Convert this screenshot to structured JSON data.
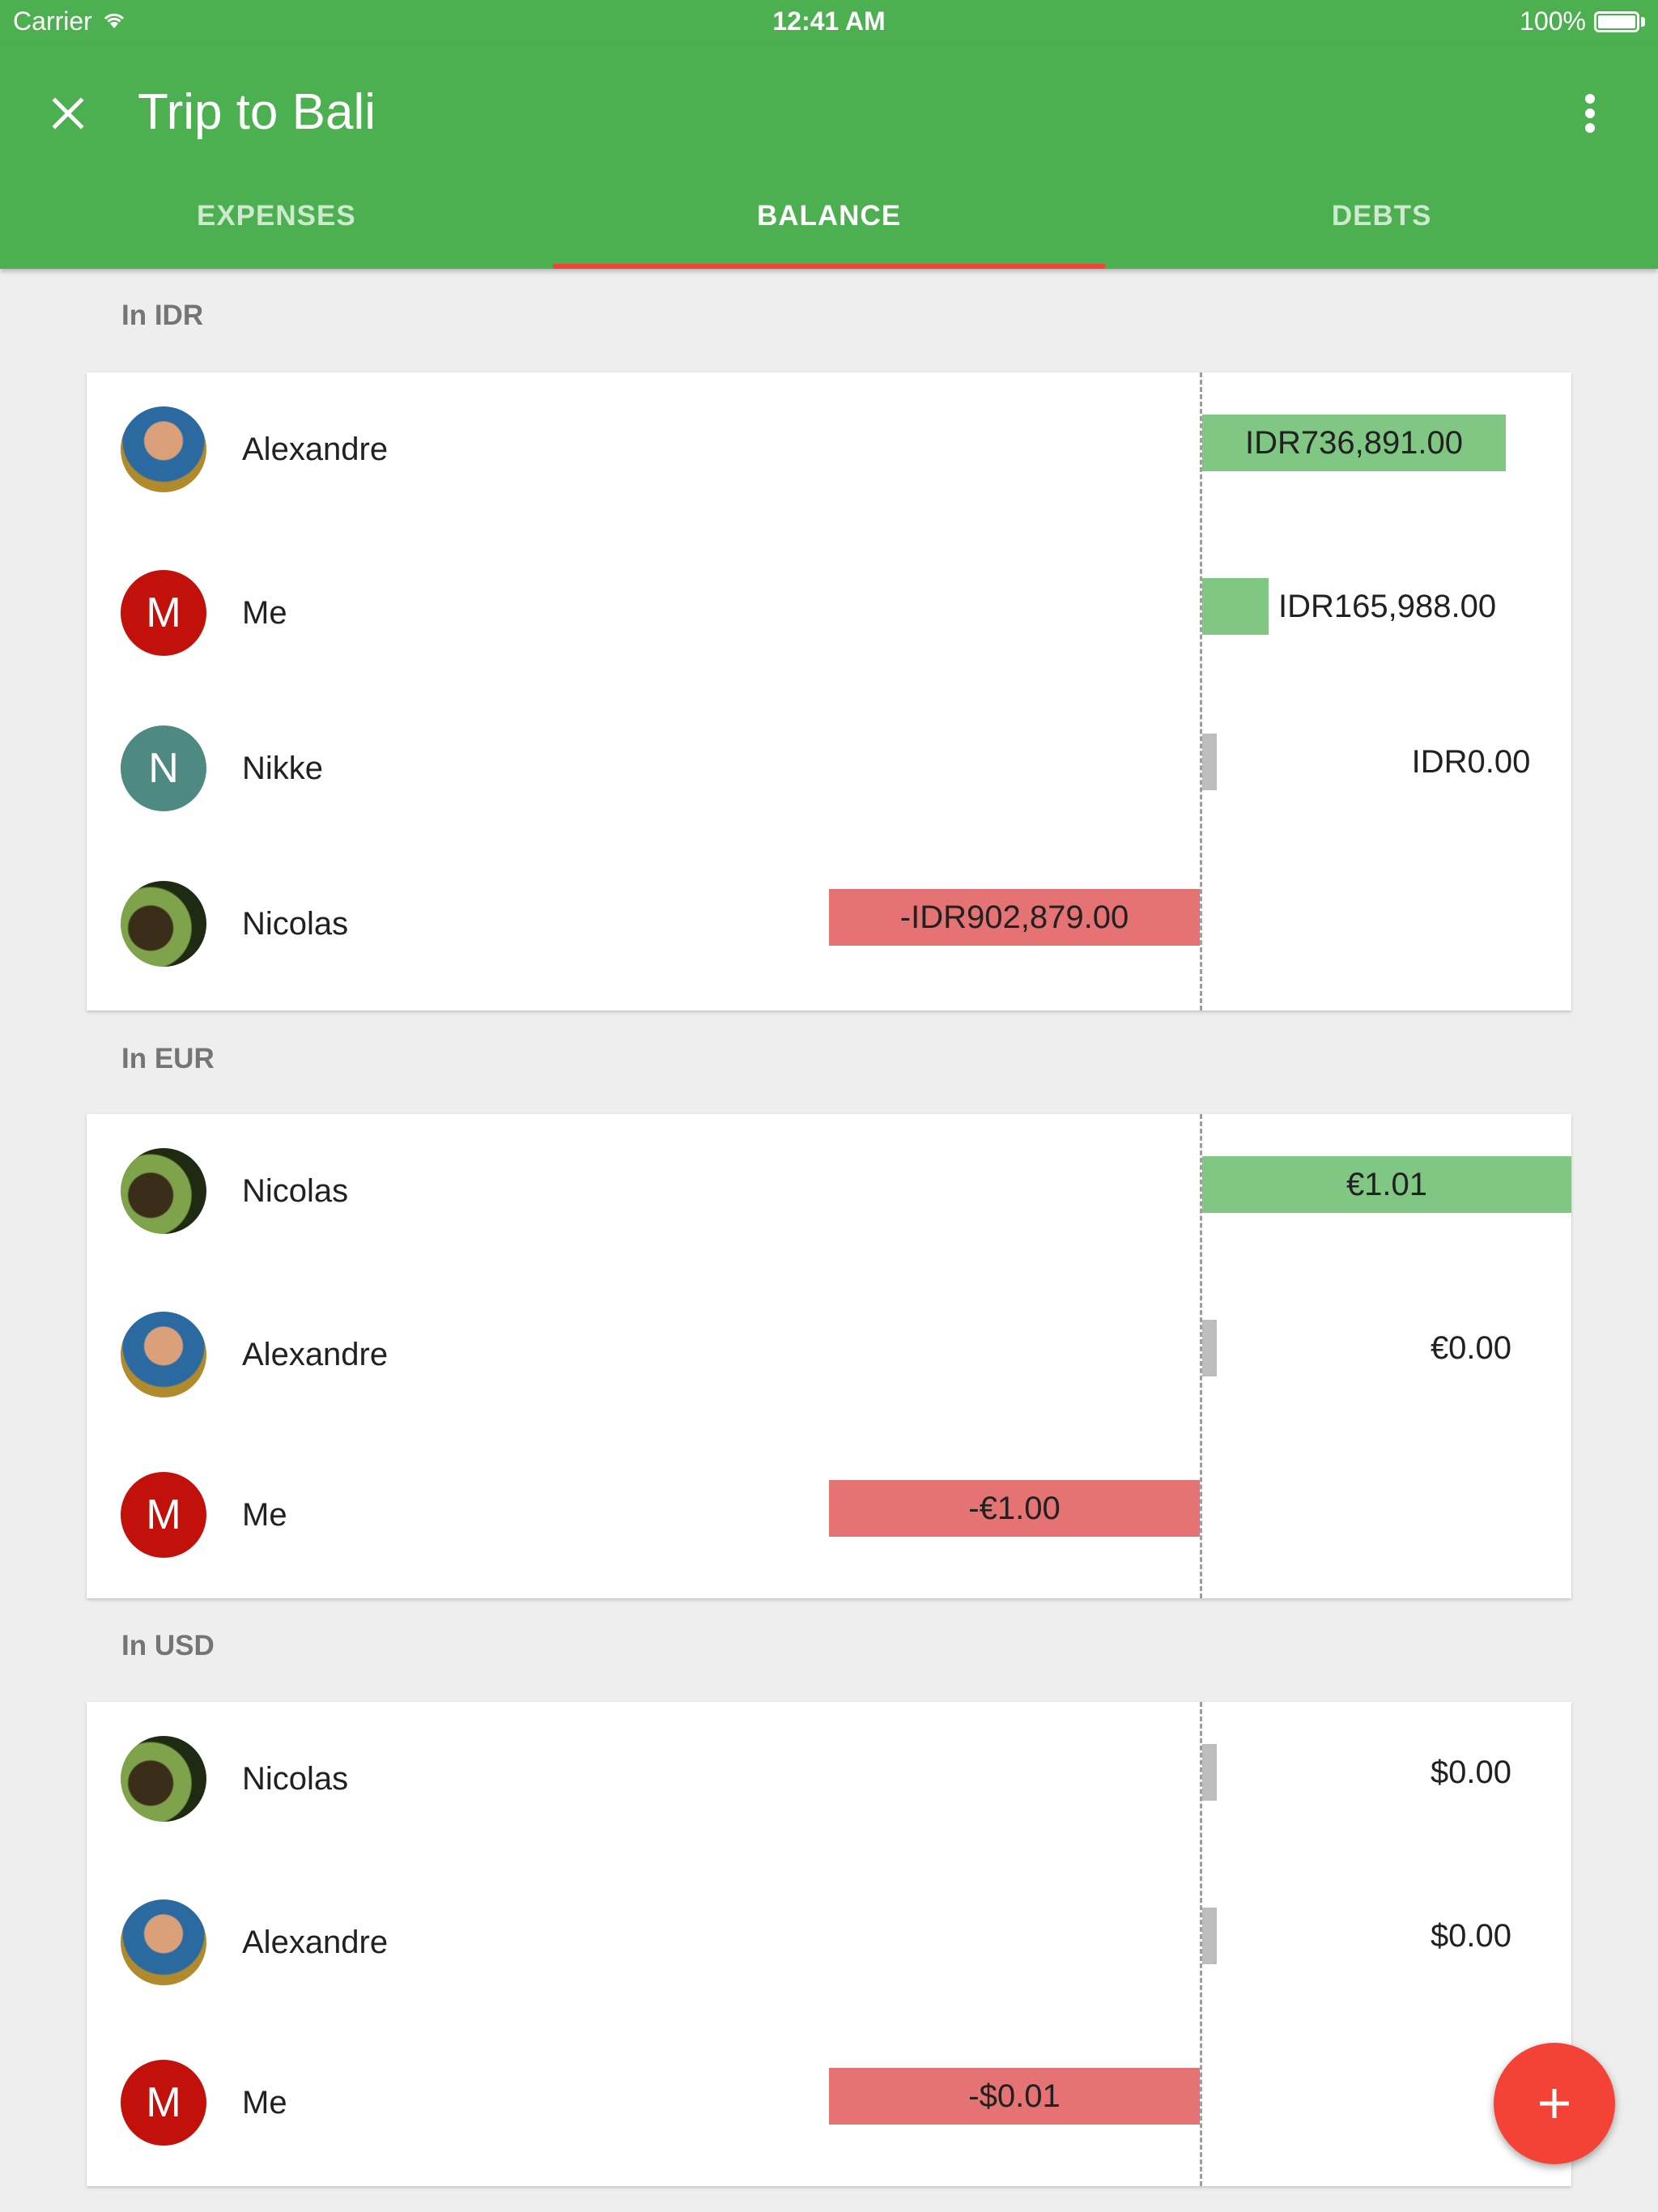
{
  "status_bar": {
    "carrier": "Carrier",
    "time": "12:41 AM",
    "battery": "100%"
  },
  "app_bar": {
    "title": "Trip to Bali",
    "tabs": [
      {
        "label": "EXPENSES",
        "active": false
      },
      {
        "label": "BALANCE",
        "active": true
      },
      {
        "label": "DEBTS",
        "active": false
      }
    ]
  },
  "colors": {
    "primary": "#4caf50",
    "accent": "#f44336",
    "positive": "#81c784",
    "negative": "#e57373",
    "zero": "#bdbdbd"
  },
  "sections": [
    {
      "label": "In IDR",
      "rows": [
        {
          "name": "Alexandre",
          "avatar": "photo",
          "amount": "IDR736,891.00",
          "value": 736891.0
        },
        {
          "name": "Me",
          "avatar": "M",
          "amount": "IDR165,988.00",
          "value": 165988.0
        },
        {
          "name": "Nikke",
          "avatar": "N",
          "amount": "IDR0.00",
          "value": 0
        },
        {
          "name": "Nicolas",
          "avatar": "photo",
          "amount": "-IDR902,879.00",
          "value": -902879.0
        }
      ]
    },
    {
      "label": "In EUR",
      "rows": [
        {
          "name": "Nicolas",
          "avatar": "photo",
          "amount": "€1.01",
          "value": 1.01
        },
        {
          "name": "Alexandre",
          "avatar": "photo",
          "amount": "€0.00",
          "value": 0
        },
        {
          "name": "Me",
          "avatar": "M",
          "amount": "-€1.00",
          "value": -1.0
        }
      ]
    },
    {
      "label": "In USD",
      "rows": [
        {
          "name": "Nicolas",
          "avatar": "photo",
          "amount": "$0.00",
          "value": 0
        },
        {
          "name": "Alexandre",
          "avatar": "photo",
          "amount": "$0.00",
          "value": 0
        },
        {
          "name": "Me",
          "avatar": "M",
          "amount": "-$0.01",
          "value": -0.01
        }
      ]
    }
  ],
  "icons": {
    "close": "close-icon",
    "menu": "more-vert-icon",
    "fab": "add-icon"
  }
}
